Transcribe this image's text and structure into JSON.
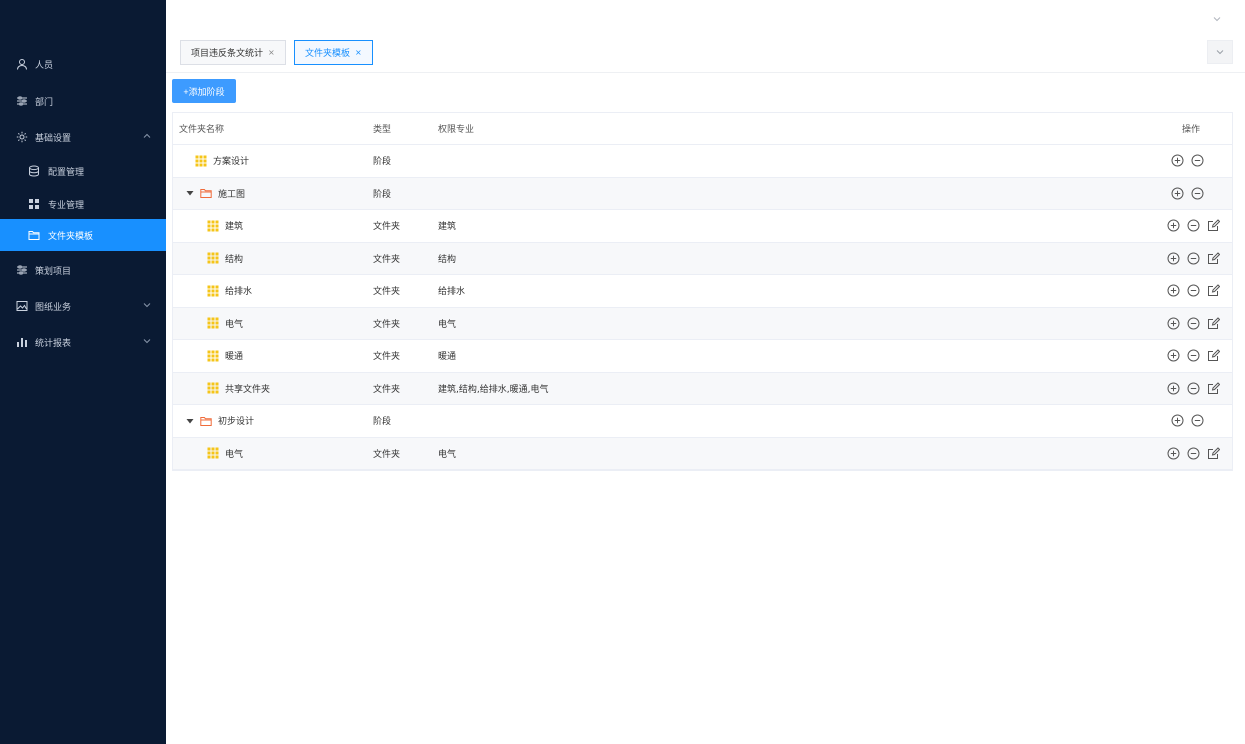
{
  "sidebar": {
    "items": [
      {
        "label": "人员",
        "icon": "user-icon"
      },
      {
        "label": "部门",
        "icon": "sliders-icon"
      },
      {
        "label": "基础设置",
        "icon": "gear-icon"
      },
      {
        "label": "配置管理",
        "icon": "database-icon"
      },
      {
        "label": "专业管理",
        "icon": "grid-icon"
      },
      {
        "label": "文件夹模板",
        "icon": "folder-icon"
      },
      {
        "label": "策划项目",
        "icon": "sliders-icon"
      },
      {
        "label": "图纸业务",
        "icon": "image-icon"
      },
      {
        "label": "统计报表",
        "icon": "bar-chart-icon"
      }
    ]
  },
  "tabs": [
    {
      "label": "项目违反条文统计",
      "close": "×"
    },
    {
      "label": "文件夹模板",
      "close": "×"
    }
  ],
  "toolbar": {
    "add_label": "+添加阶段"
  },
  "table": {
    "headers": {
      "name": "文件夹名称",
      "type": "类型",
      "major": "权限专业",
      "ops": "操作"
    },
    "rows": [
      {
        "name": "方案设计",
        "type": "阶段",
        "major": ""
      },
      {
        "name": "施工图",
        "type": "阶段",
        "major": ""
      },
      {
        "name": "建筑",
        "type": "文件夹",
        "major": "建筑"
      },
      {
        "name": "结构",
        "type": "文件夹",
        "major": "结构"
      },
      {
        "name": "给排水",
        "type": "文件夹",
        "major": "给排水"
      },
      {
        "name": "电气",
        "type": "文件夹",
        "major": "电气"
      },
      {
        "name": "暖通",
        "type": "文件夹",
        "major": "暖通"
      },
      {
        "name": "共享文件夹",
        "type": "文件夹",
        "major": "建筑,结构,给排水,暖通,电气"
      },
      {
        "name": "初步设计",
        "type": "阶段",
        "major": ""
      },
      {
        "name": "电气",
        "type": "文件夹",
        "major": "电气"
      }
    ]
  },
  "colors": {
    "sidebar_bg": "#0a1a33",
    "accent": "#1890ff",
    "folder": "#f06b3a",
    "grid": "#f5c518"
  }
}
